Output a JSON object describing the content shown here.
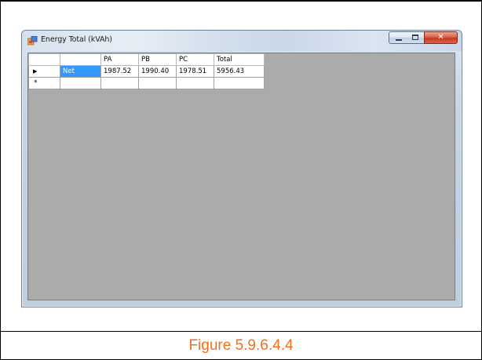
{
  "window": {
    "title": "Energy Total (kVAh)",
    "controls": {
      "minimize": "minimize",
      "maximize": "maximize",
      "close": "✕"
    }
  },
  "grid": {
    "columns": [
      "PA",
      "PB",
      "PC",
      "Total"
    ],
    "rows": [
      {
        "indicator": "▶",
        "label": "Net",
        "values": [
          "1987.52",
          "1990.40",
          "1978.51",
          "5956.43"
        ]
      },
      {
        "indicator": "*",
        "label": "",
        "values": [
          "",
          "",
          "",
          ""
        ]
      }
    ]
  },
  "caption": "Figure 5.9.6.4.4",
  "colors": {
    "selection": "#3399ff",
    "client_background": "#ababab",
    "caption": "#f36f1b"
  }
}
